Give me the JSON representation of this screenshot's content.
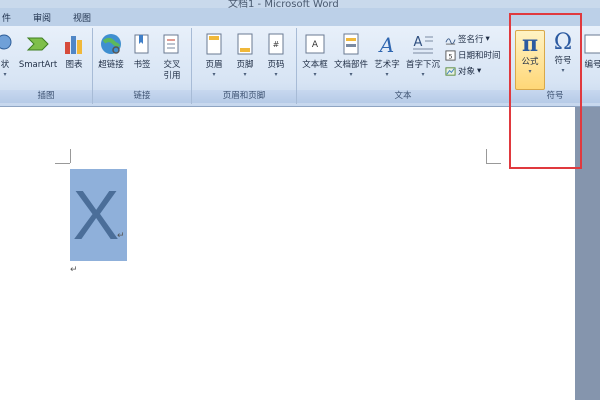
{
  "window": {
    "title": "文档1 - Microsoft Word"
  },
  "tabs": [
    {
      "label": "件"
    },
    {
      "label": "审阅"
    },
    {
      "label": "视图"
    }
  ],
  "ribbon": {
    "illustrations": {
      "label": "插图",
      "items": [
        {
          "label": "状",
          "icon": "shapes-icon"
        },
        {
          "label": "SmartArt",
          "icon": "smartart-icon"
        },
        {
          "label": "图表",
          "icon": "chart-icon"
        }
      ]
    },
    "links": {
      "label": "链接",
      "items": [
        {
          "label": "超链接",
          "icon": "hyperlink-icon"
        },
        {
          "label": "书签",
          "icon": "bookmark-icon"
        },
        {
          "label_line1": "交叉",
          "label_line2": "引用",
          "icon": "cross-reference-icon"
        }
      ]
    },
    "header_footer": {
      "label": "页眉和页脚",
      "items": [
        {
          "label": "页眉",
          "icon": "header-icon"
        },
        {
          "label": "页脚",
          "icon": "footer-icon"
        },
        {
          "label": "页码",
          "icon": "page-number-icon"
        }
      ]
    },
    "text": {
      "label": "文本",
      "items": [
        {
          "label": "文本框",
          "icon": "textbox-icon"
        },
        {
          "label": "文档部件",
          "icon": "quickparts-icon"
        },
        {
          "label": "艺术字",
          "icon": "wordart-icon"
        },
        {
          "label": "首字下沉",
          "icon": "dropcap-icon"
        }
      ],
      "small": [
        {
          "label": "签名行",
          "icon": "signature-icon"
        },
        {
          "label": "日期和时间",
          "icon": "datetime-icon"
        },
        {
          "label": "对象",
          "icon": "object-icon"
        }
      ]
    },
    "symbols": {
      "label": "符号",
      "items": [
        {
          "label": "公式",
          "glyph": "π",
          "icon": "equation-icon"
        },
        {
          "label": "符号",
          "glyph": "Ω",
          "icon": "symbol-icon"
        },
        {
          "label": "编号",
          "icon": "numbering-icon"
        }
      ]
    }
  },
  "document": {
    "content": "X",
    "para_mark": "↵"
  }
}
